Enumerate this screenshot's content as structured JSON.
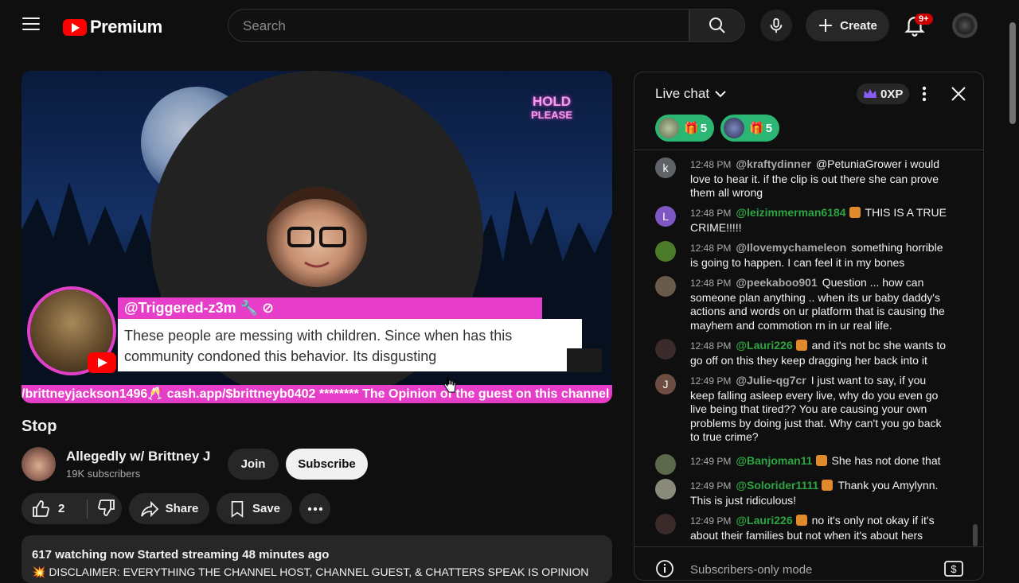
{
  "header": {
    "logo_text": "Premium",
    "search_placeholder": "Search",
    "create_label": "Create",
    "notification_count": "9+"
  },
  "video": {
    "hold_text_1": "HOLD",
    "hold_text_2": "PLEASE",
    "featured_comment": {
      "author": "@Triggered-z3m",
      "text": "These people are messing with children. Since when has this community condoned this behavior. Its disgusting"
    },
    "ticker": "/brittneyjackson1496🥂 cash.app/$brittneyb0402 ******** The Opinion of the guest on this channel"
  },
  "details": {
    "title": "Stop",
    "channel_name": "Allegedly w/ Brittney J",
    "subscribers": "19K subscribers",
    "join_label": "Join",
    "subscribe_label": "Subscribe",
    "like_count": "2",
    "share_label": "Share",
    "save_label": "Save",
    "description_line1": "617 watching now  Started streaming 48 minutes ago",
    "description_line2": "💥 DISCLAIMER: EVERYTHING THE CHANNEL HOST, CHANNEL GUEST, & CHATTERS SPEAK IS OPINION"
  },
  "chat": {
    "title": "Live chat",
    "xp_label": "0XP",
    "stickers": [
      {
        "count": "5"
      },
      {
        "count": "5"
      }
    ],
    "messages": [
      {
        "avatar": "k",
        "avatar_color": "#5f6368",
        "time": "12:48 PM",
        "author": "@kraftydinner",
        "member": false,
        "text": "@PetuniaGrower i would love to hear it. if the clip is out there she can prove them all wrong"
      },
      {
        "avatar": "L",
        "avatar_color": "#7e57c2",
        "time": "12:48 PM",
        "author": "@leizimmerman6184",
        "member": true,
        "text": "THIS IS A TRUE CRIME!!!!!"
      },
      {
        "avatar": "",
        "avatar_color": "#4a7a2a",
        "time": "12:48 PM",
        "author": "@Ilovemychameleon",
        "member": false,
        "text": "something horrible is going to happen. I can feel it in my bones"
      },
      {
        "avatar": "",
        "avatar_color": "#6a5a4a",
        "time": "12:48 PM",
        "author": "@peekaboo901",
        "member": false,
        "text": "Question ... how can someone plan anything .. when its ur baby daddy's actions and words on ur platform that is causing the mayhem and commotion rn in ur real life."
      },
      {
        "avatar": "",
        "avatar_color": "#3a2a2a",
        "time": "12:48 PM",
        "author": "@Lauri226",
        "member": true,
        "text": "and it's not bc she wants to go off on this they keep dragging her back into it"
      },
      {
        "avatar": "J",
        "avatar_color": "#6d4c41",
        "time": "12:49 PM",
        "author": "@Julie-qg7cr",
        "member": false,
        "text": "I just want to say, if you keep falling asleep every live, why do you even go live being that tired?? You are causing your own problems by doing just that. Why can't you go back to true crime?"
      },
      {
        "avatar": "",
        "avatar_color": "#5a6a4a",
        "time": "12:49 PM",
        "author": "@Banjoman11",
        "member": true,
        "text": "She has not done that"
      },
      {
        "avatar": "",
        "avatar_color": "#8a8a7a",
        "time": "12:49 PM",
        "author": "@Solorider1111",
        "member": true,
        "text": "Thank you Amylynn. This is just ridiculous!"
      },
      {
        "avatar": "",
        "avatar_color": "#3a2a2a",
        "time": "12:49 PM",
        "author": "@Lauri226",
        "member": true,
        "text": "no it's only not okay if it's about their families but not when it's about hers"
      }
    ],
    "footer_text": "Subscribers-only mode"
  }
}
